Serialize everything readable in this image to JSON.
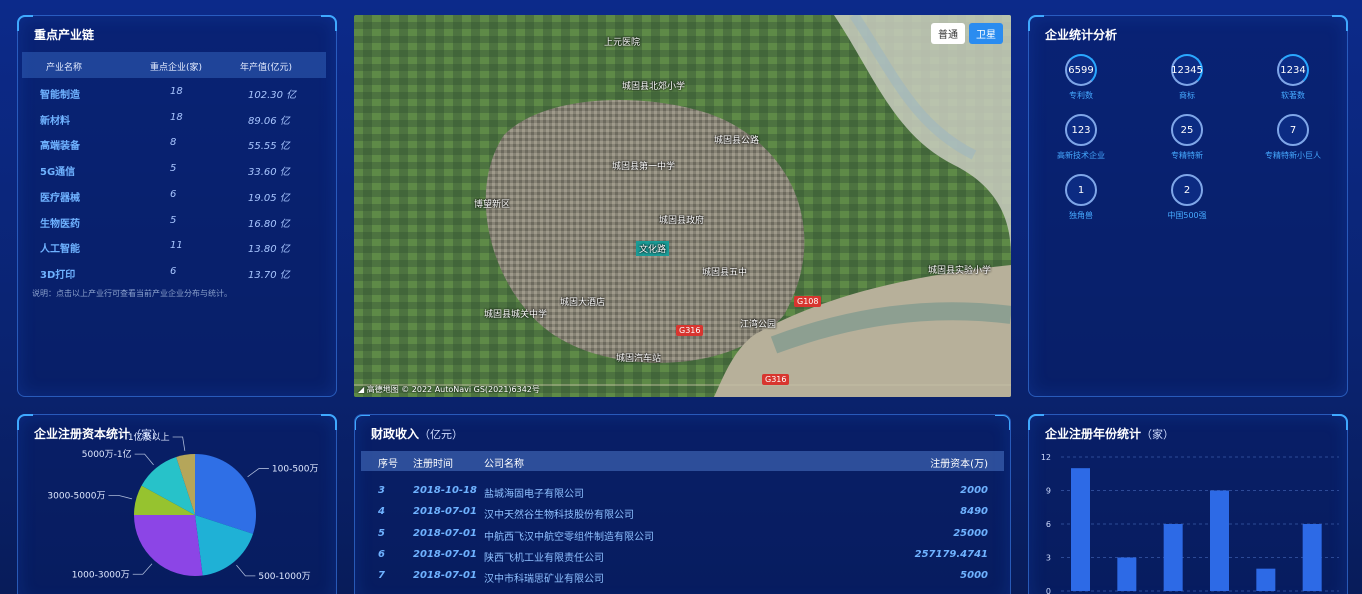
{
  "industry_chain": {
    "title": "重点产业链",
    "headers": [
      "产业名称",
      "重点企业(家)",
      "年产值(亿元)"
    ],
    "rows": [
      {
        "name": "智能制造",
        "count": "18",
        "value": "102.30 亿"
      },
      {
        "name": "新材料",
        "count": "18",
        "value": "89.06 亿"
      },
      {
        "name": "高端装备",
        "count": "8",
        "value": "55.55 亿"
      },
      {
        "name": "5G通信",
        "count": "5",
        "value": "33.60 亿"
      },
      {
        "name": "医疗器械",
        "count": "6",
        "value": "19.05 亿"
      },
      {
        "name": "生物医药",
        "count": "5",
        "value": "16.80 亿"
      },
      {
        "name": "人工智能",
        "count": "11",
        "value": "13.80 亿"
      },
      {
        "name": "3D打印",
        "count": "6",
        "value": "13.70 亿"
      }
    ],
    "note": "说明：点击以上产业行可查看当前产业企业分布与统计。"
  },
  "map": {
    "btn_normal": "普通",
    "btn_satellite": "卫星",
    "labels": [
      "上元医院",
      "城固县北郊小学",
      "城固县第一中学",
      "城固县政府",
      "城固县公路",
      "城固县五中",
      "城固县实验小学",
      "文化路",
      "城固县城关中学",
      "城固汽车站",
      "江湾公园",
      "博望新区",
      "城固大酒店"
    ],
    "roads": [
      "G316",
      "G108",
      "G316"
    ],
    "footer": "高德地图 © 2022 AutoNavi GS(2021)6342号"
  },
  "enterprise_stats": {
    "title": "企业统计分析",
    "items": [
      {
        "value": "6599",
        "label": "专利数"
      },
      {
        "value": "12345",
        "label": "商标"
      },
      {
        "value": "1234",
        "label": "软著数"
      },
      {
        "value": "123",
        "label": "高新技术企业"
      },
      {
        "value": "25",
        "label": "专精特新"
      },
      {
        "value": "7",
        "label": "专精特新小巨人"
      },
      {
        "value": "1",
        "label": "独角兽"
      },
      {
        "value": "2",
        "label": "中国500强"
      }
    ]
  },
  "capital_stats": {
    "title": "企业注册资本统计",
    "unit": "（家）"
  },
  "finance": {
    "title": "财政收入",
    "unit": "（亿元）",
    "headers": [
      "序号",
      "注册时间",
      "公司名称",
      "注册资本(万)"
    ],
    "rows": [
      {
        "idx": "3",
        "date": "2018-10-18",
        "name": "盐城海固电子有限公司",
        "capital": "2000"
      },
      {
        "idx": "4",
        "date": "2018-07-01",
        "name": "汉中天然谷生物科技股份有限公司",
        "capital": "8490"
      },
      {
        "idx": "5",
        "date": "2018-07-01",
        "name": "中航西飞汉中航空零组件制造有限公司",
        "capital": "25000"
      },
      {
        "idx": "6",
        "date": "2018-07-01",
        "name": "陕西飞机工业有限责任公司",
        "capital": "257179.4741"
      },
      {
        "idx": "7",
        "date": "2018-07-01",
        "name": "汉中市科瑞思矿业有限公司",
        "capital": "5000"
      }
    ]
  },
  "year_stats": {
    "title": "企业注册年份统计",
    "unit": "（家）"
  },
  "chart_data": [
    {
      "type": "pie",
      "title": "企业注册资本统计（家）",
      "categories": [
        "100-500万",
        "500-1000万",
        "1000-3000万",
        "3000-5000万",
        "5000万-1亿",
        "1亿及以上"
      ],
      "values": [
        30,
        18,
        27,
        8,
        12,
        5
      ],
      "colors": [
        "#2f6fe6",
        "#1fb1d6",
        "#8c45e6",
        "#96c32f",
        "#27c2c9",
        "#b5a65a"
      ]
    },
    {
      "type": "bar",
      "title": "企业注册年份统计（家）",
      "values": [
        11,
        3,
        6,
        9,
        2,
        6
      ],
      "ylim": [
        0,
        12
      ],
      "yticks": [
        "0",
        "3",
        "6",
        "9",
        "12"
      ],
      "grid": true,
      "color": "#2d6ae6"
    }
  ]
}
